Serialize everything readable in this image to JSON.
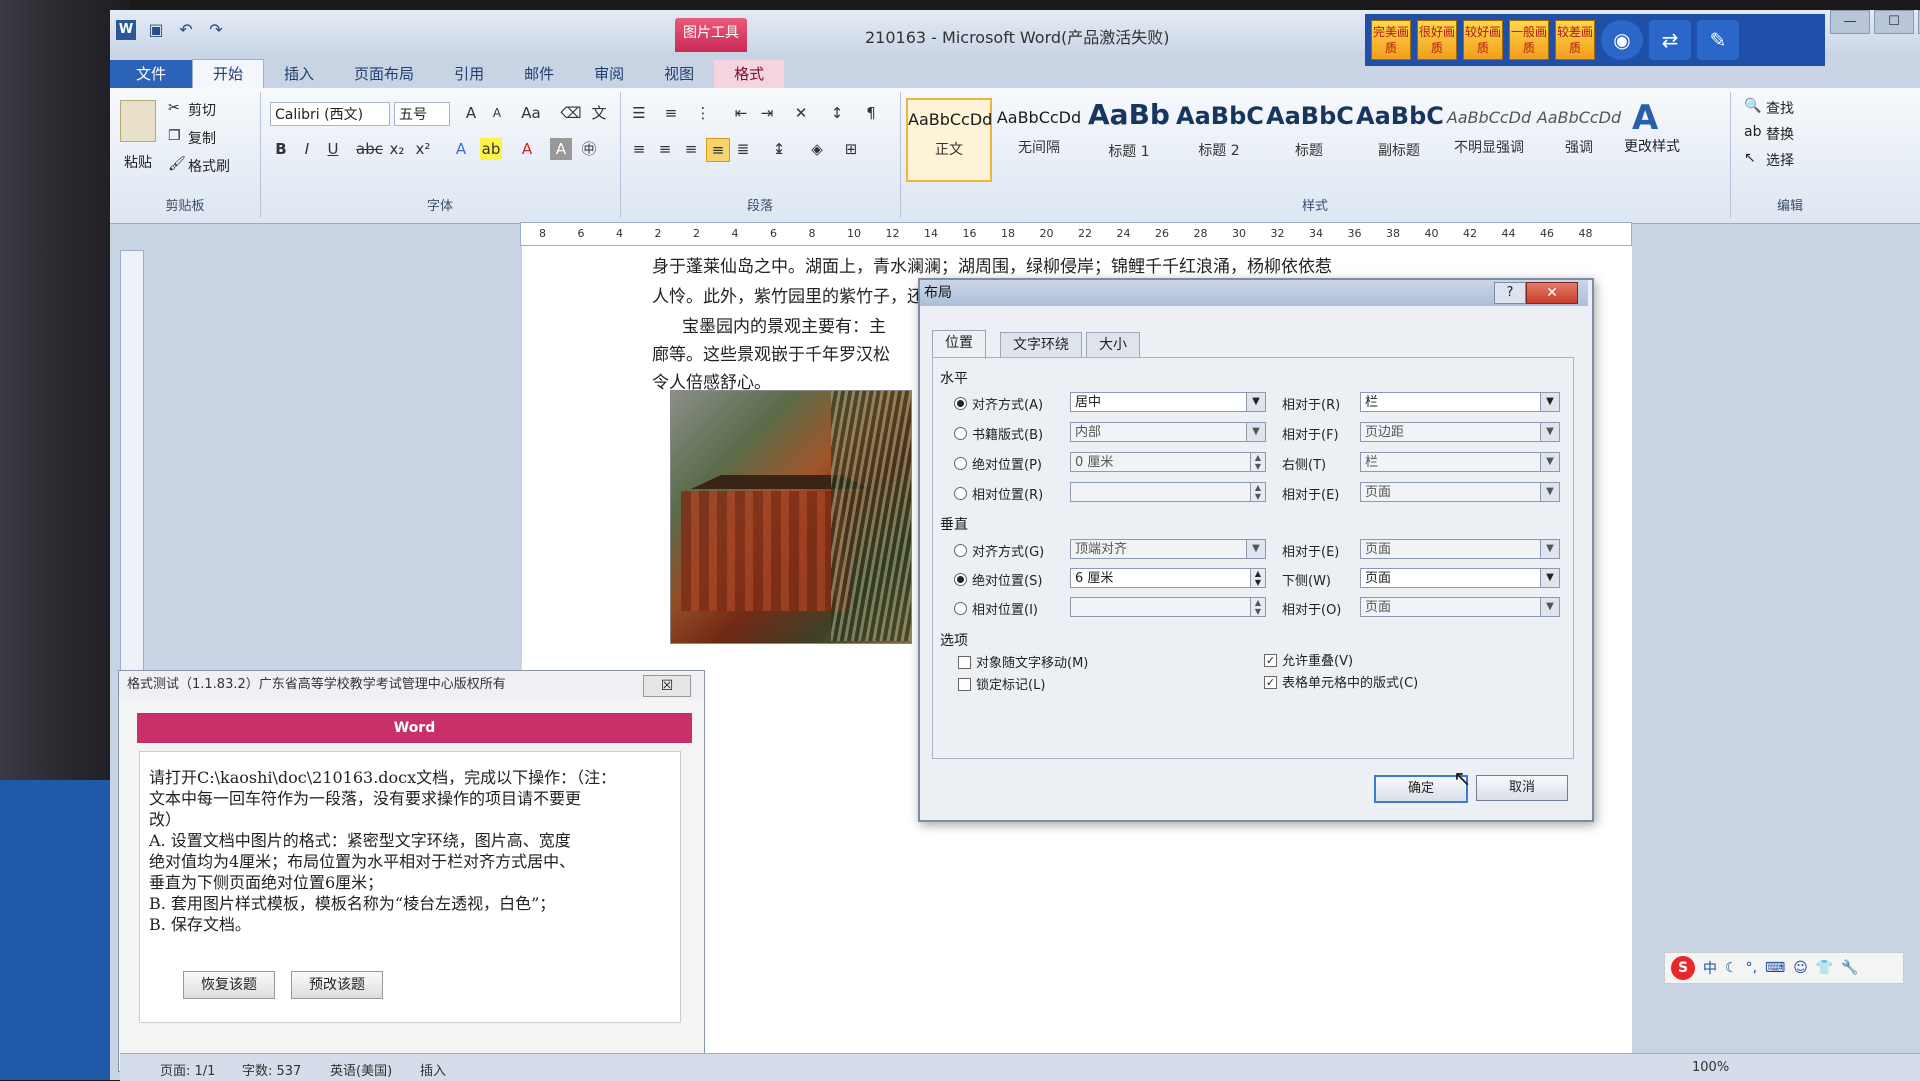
{
  "window": {
    "title": "210163 - Microsoft Word(产品激活失败)",
    "picture_tools": "图片工具",
    "controls": [
      "—",
      "☐",
      "✕"
    ]
  },
  "addons": [
    "完美画质",
    "很好画质",
    "较好画质",
    "一般画质",
    "较差画质"
  ],
  "tabs": [
    {
      "label": "文件"
    },
    {
      "label": "开始"
    },
    {
      "label": "插入"
    },
    {
      "label": "页面布局"
    },
    {
      "label": "引用"
    },
    {
      "label": "邮件"
    },
    {
      "label": "审阅"
    },
    {
      "label": "视图"
    },
    {
      "label": "格式"
    }
  ],
  "ribbon": {
    "clipboard": {
      "paste": "粘贴",
      "cut": "剪切",
      "copy": "复制",
      "painter": "格式刷",
      "label": "剪贴板"
    },
    "font": {
      "name": "Calibri (西文)",
      "size": "五号",
      "label": "字体"
    },
    "paragraph": {
      "label": "段落"
    },
    "styles": {
      "label": "样式",
      "items": [
        {
          "sample": "AaBbCcDd",
          "name": "正文"
        },
        {
          "sample": "AaBbCcDd",
          "name": "无间隔"
        },
        {
          "sample": "AaBb",
          "name": "标题 1"
        },
        {
          "sample": "AaBbC",
          "name": "标题 2"
        },
        {
          "sample": "AaBbC",
          "name": "标题"
        },
        {
          "sample": "AaBbC",
          "name": "副标题"
        },
        {
          "sample": "AaBbCcDd",
          "name": "不明显强调"
        },
        {
          "sample": "AaBbCcDd",
          "name": "强调"
        }
      ],
      "change": "更改样式"
    },
    "editing": {
      "find": "查找",
      "replace": "替换",
      "select": "选择",
      "label": "编辑"
    }
  },
  "ruler": [
    "8",
    "6",
    "4",
    "2",
    "2",
    "4",
    "6",
    "8",
    "10",
    "12",
    "14",
    "16",
    "18",
    "20",
    "22",
    "24",
    "26",
    "28",
    "30",
    "32",
    "34",
    "36",
    "38",
    "40",
    "42",
    "44",
    "46",
    "48"
  ],
  "document": {
    "lines": [
      "身于蓬莱仙岛之中。湖面上，青水澜澜；湖周围，绿柳侵岸；锦鲤千千红浪涌，杨柳依依惹",
      "人怜。此外，紫竹园里的紫竹子，还有些小孩玩水观鱼，更是儿童的欢乐天地。",
      "宝墨园内的景观主要有：主",
      "廊等。这些景观嵌于千年罗汉松",
      "令人倍感舒心。"
    ]
  },
  "test_panel": {
    "title": "格式测试（1.1.83.2）广东省高等学校教学考试管理中心版权所有",
    "close": "☒",
    "banner": "Word",
    "instructions": [
      "请打开C:\\kaoshi\\doc\\210163.docx文档，完成以下操作：（注：",
      "文本中每一回车符作为一段落，没有要求操作的项目请不要更",
      "改）",
      "A. 设置文档中图片的格式：紧密型文字环绕，图片高、宽度",
      "绝对值均为4厘米；布局位置为水平相对于栏对齐方式居中、",
      "垂直为下侧页面绝对位置6厘米；",
      "B. 套用图片样式模板，模板名称为“棱台左透视，白色”；",
      "B. 保存文档。"
    ],
    "restore_button": "恢复该题",
    "grade_button": "预改该题"
  },
  "dialog": {
    "title": "布局",
    "help": "?",
    "close": "✕",
    "tabs": [
      "位置",
      "文字环绕",
      "大小"
    ],
    "horizontal": {
      "label": "水平",
      "rows": [
        {
          "option": "对齐方式(A)",
          "value": "居中",
          "rel_label": "相对于(R)",
          "rel_value": "栏",
          "checked": true
        },
        {
          "option": "书籍版式(B)",
          "value": "内部",
          "rel_label": "相对于(F)",
          "rel_value": "页边距",
          "checked": false
        },
        {
          "option": "绝对位置(P)",
          "value": "0 厘米",
          "rel_label": "右侧(T)",
          "rel_value": "栏",
          "checked": false
        },
        {
          "option": "相对位置(R)",
          "value": "",
          "rel_label": "相对于(E)",
          "rel_value": "页面",
          "checked": false
        }
      ]
    },
    "vertical": {
      "label": "垂直",
      "rows": [
        {
          "option": "对齐方式(G)",
          "value": "顶端对齐",
          "rel_label": "相对于(E)",
          "rel_value": "页面",
          "checked": false
        },
        {
          "option": "绝对位置(S)",
          "value": "6 厘米",
          "rel_label": "下侧(W)",
          "rel_value": "页面",
          "checked": true
        },
        {
          "option": "相对位置(I)",
          "value": "",
          "rel_label": "相对于(O)",
          "rel_value": "页面",
          "checked": false
        }
      ]
    },
    "options": {
      "label": "选项",
      "move_with_text": "对象随文字移动(M)",
      "lock_anchor": "锁定标记(L)",
      "allow_overlap": "允许重叠(V)",
      "layout_in_cell": "表格单元格中的版式(C)"
    },
    "ok": "确定",
    "cancel": "取消"
  },
  "status": {
    "page": "页面: 1/1",
    "words": "字数: 537",
    "lang": "英语(美国)",
    "mode": "插入",
    "zoom": "100%"
  },
  "ime": {
    "logo": "S",
    "mode": "中"
  }
}
